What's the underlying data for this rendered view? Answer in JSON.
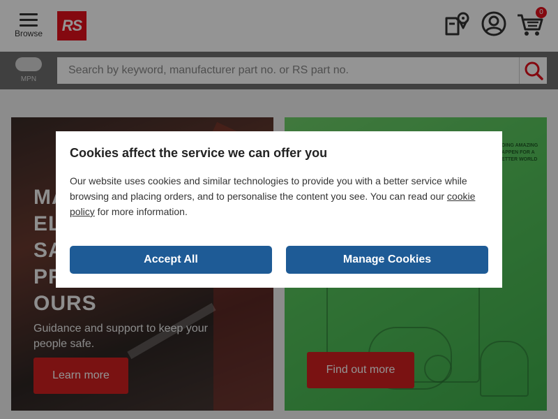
{
  "header": {
    "browse_label": "Browse",
    "logo_text": "RS",
    "cart_count": "0",
    "brand_color": "#e3101d",
    "icons": [
      "menu-icon",
      "order-tracking-icon",
      "account-icon",
      "cart-icon"
    ]
  },
  "search": {
    "toggle_label": "MPN",
    "placeholder": "Search by keyword, manufacturer part no. or RS part no.",
    "value": "",
    "button_icon": "search-icon"
  },
  "promo_left": {
    "heading": "MA\nEL\nSA\nPR\nOURS",
    "text": "Guidance and support to keep your people safe.",
    "button_label": "Learn more"
  },
  "promo_right": {
    "tagline": "DOING AMAZING\nHAPPEN FOR A\nBETTER WORLD",
    "button_label": "Find out more"
  },
  "cookie_dialog": {
    "title": "Cookies affect the service we can offer you",
    "body_before": "Our website uses cookies and similar technologies to provide you with a better service while browsing and placing orders, and to personalise the content you see. You can read our ",
    "link_text": "cookie policy",
    "body_after": " for more information.",
    "accept_label": "Accept All",
    "manage_label": "Manage Cookies",
    "button_color": "#1e5b96"
  }
}
